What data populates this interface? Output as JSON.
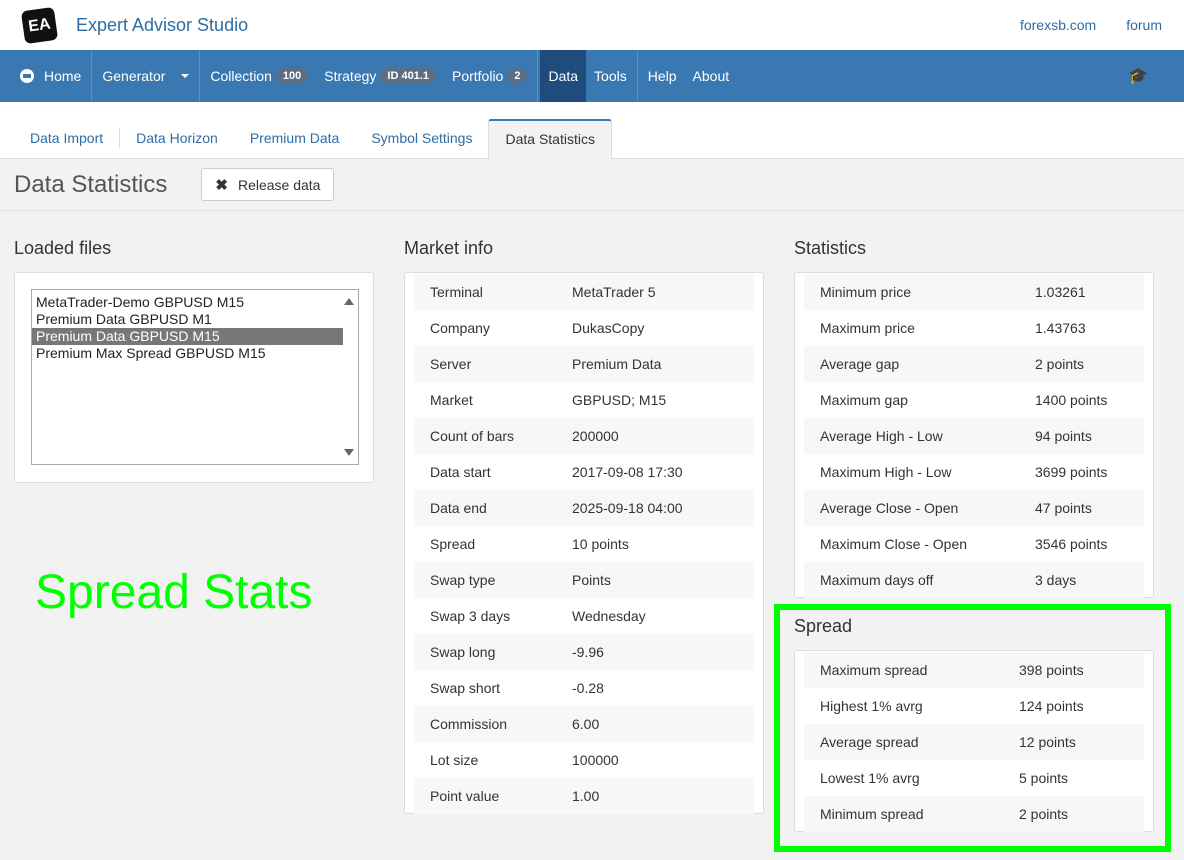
{
  "app": {
    "logo_text": "EA",
    "title": "Expert Advisor Studio",
    "links": [
      "forexsb.com",
      "forum"
    ]
  },
  "nav": {
    "home": "Home",
    "generator": "Generator",
    "collection": "Collection",
    "collection_badge": "100",
    "strategy": "Strategy",
    "strategy_badge": "ID 401.1",
    "portfolio": "Portfolio",
    "portfolio_badge": "2",
    "data": "Data",
    "tools": "Tools",
    "help": "Help",
    "about": "About"
  },
  "tabs": [
    "Data Import",
    "Data Horizon",
    "Premium Data",
    "Symbol Settings",
    "Data Statistics"
  ],
  "page": {
    "title": "Data Statistics",
    "release_button": "Release data"
  },
  "loaded_files": {
    "title": "Loaded files",
    "items": [
      "MetaTrader-Demo GBPUSD M15",
      "Premium Data GBPUSD M1",
      "Premium Data GBPUSD M15",
      "Premium Max Spread GBPUSD M15"
    ],
    "selected_index": 2
  },
  "market_info": {
    "title": "Market info",
    "rows": [
      [
        "Terminal",
        "MetaTrader 5"
      ],
      [
        "Company",
        "DukasCopy"
      ],
      [
        "Server",
        "Premium Data"
      ],
      [
        "Market",
        "GBPUSD; M15"
      ],
      [
        "Count of bars",
        "200000"
      ],
      [
        "Data start",
        "2017-09-08 17:30"
      ],
      [
        "Data end",
        "2025-09-18 04:00"
      ],
      [
        "Spread",
        "10 points"
      ],
      [
        "Swap type",
        "Points"
      ],
      [
        "Swap 3 days",
        "Wednesday"
      ],
      [
        "Swap long",
        "-9.96"
      ],
      [
        "Swap short",
        "-0.28"
      ],
      [
        "Commission",
        "6.00"
      ],
      [
        "Lot size",
        "100000"
      ],
      [
        "Point value",
        "1.00"
      ]
    ]
  },
  "statistics": {
    "title": "Statistics",
    "rows": [
      [
        "Minimum price",
        "1.03261"
      ],
      [
        "Maximum price",
        "1.43763"
      ],
      [
        "Average gap",
        "2 points"
      ],
      [
        "Maximum gap",
        "1400 points"
      ],
      [
        "Average High - Low",
        "94 points"
      ],
      [
        "Maximum High - Low",
        "3699 points"
      ],
      [
        "Average Close - Open",
        "47 points"
      ],
      [
        "Maximum Close - Open",
        "3546 points"
      ],
      [
        "Maximum days off",
        "3 days"
      ]
    ]
  },
  "spread": {
    "title": "Spread",
    "rows": [
      [
        "Maximum spread",
        "398 points"
      ],
      [
        "Highest 1% avrg",
        "124 points"
      ],
      [
        "Average spread",
        "12 points"
      ],
      [
        "Lowest 1% avrg",
        "5 points"
      ],
      [
        "Minimum spread",
        "2 points"
      ]
    ]
  },
  "annotation": {
    "text": "Spread Stats",
    "color": "#00ff00"
  }
}
